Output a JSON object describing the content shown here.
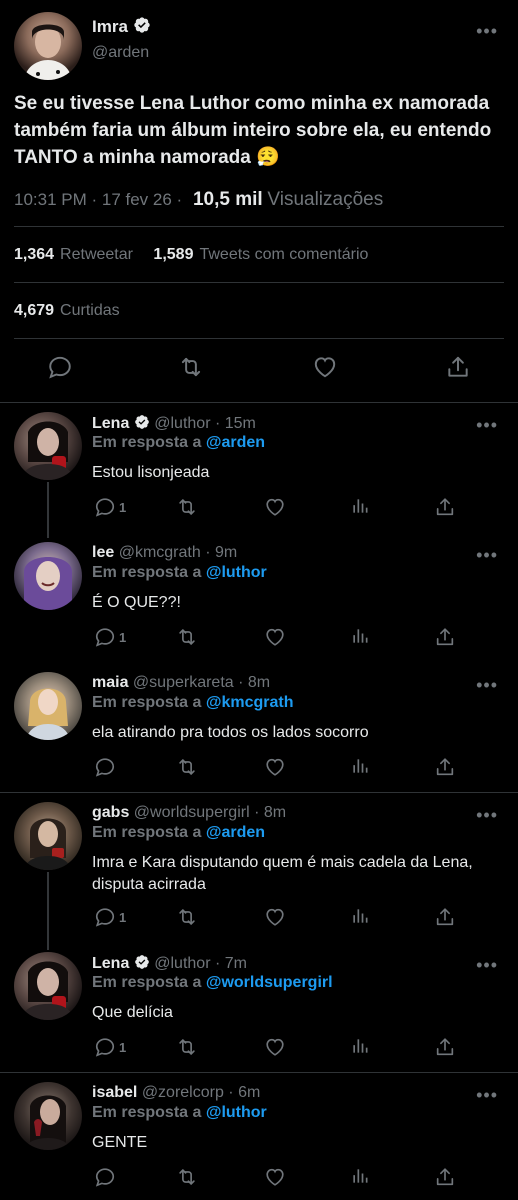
{
  "main": {
    "name": "Imra",
    "handle": "@arden",
    "text": "Se eu tivesse Lena Luthor como minha ex namorada também faria um álbum inteiro sobre ela, eu entendo TANTO a minha namorada 😮‍💨",
    "time": "10:31 PM · 17 fev 26 ·",
    "views_count": "10,5 mil",
    "views_label": "Visualizações",
    "retweets_count": "1,364",
    "retweets_label": "Retweetar",
    "quotes_count": "1,589",
    "quotes_label": "Tweets com comentário",
    "likes_count": "4,679",
    "likes_label": "Curtidas",
    "more_icon": "more-icon",
    "colors": {
      "accent": "#1d9bf0",
      "background": "#000000",
      "muted": "#71767b"
    }
  },
  "replies": [
    {
      "name": "Lena",
      "verified": true,
      "handle": "@luthor · 15m",
      "reply_prefix": "Em resposta a",
      "reply_to": "@arden",
      "text": "Estou lisonjeada",
      "reply_count": "1"
    },
    {
      "name": "lee",
      "verified": false,
      "handle": "@kmcgrath · 9m",
      "reply_prefix": "Em resposta a",
      "reply_to": "@luthor",
      "text": "É O QUE??!",
      "reply_count": "1"
    },
    {
      "name": "maia",
      "verified": false,
      "handle": "@superkareta · 8m",
      "reply_prefix": "Em resposta a",
      "reply_to": "@kmcgrath",
      "text": "ela atirando pra todos os lados socorro",
      "reply_count": ""
    },
    {
      "name": "gabs",
      "verified": false,
      "handle": "@worldsupergirl · 8m",
      "reply_prefix": "Em resposta a",
      "reply_to": "@arden",
      "text": "Imra e Kara disputando quem é mais cadela da Lena, disputa acirrada",
      "reply_count": "1"
    },
    {
      "name": "Lena",
      "verified": true,
      "handle": "@luthor · 7m",
      "reply_prefix": "Em resposta a",
      "reply_to": "@worldsupergirl",
      "text": "Que delícia",
      "reply_count": "1"
    },
    {
      "name": "isabel",
      "verified": false,
      "handle": "@zorelcorp · 6m",
      "reply_prefix": "Em resposta a",
      "reply_to": "@luthor",
      "text": "GENTE",
      "reply_count": ""
    }
  ]
}
